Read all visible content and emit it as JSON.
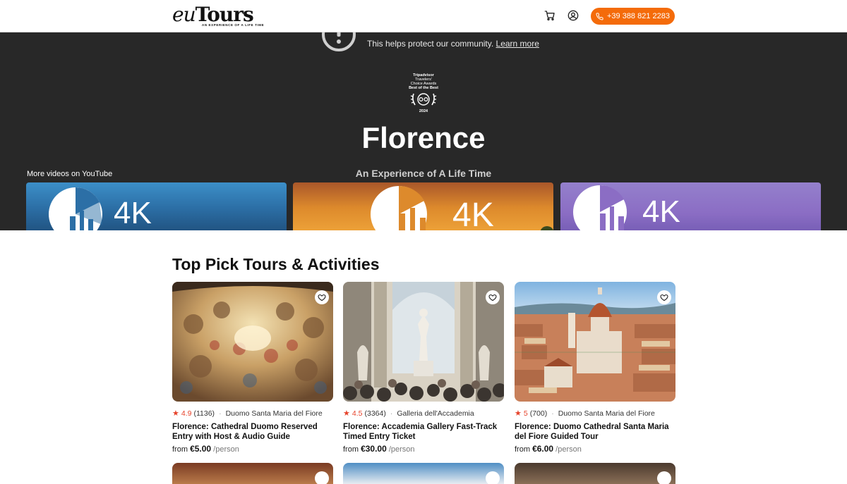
{
  "header": {
    "logo_main_prefix": "eu",
    "logo_main_suffix": "Tours",
    "logo_tagline": "AN EXPERIENCE OF A LIFE TIME",
    "phone_label": "+39 388 821 2283"
  },
  "hero": {
    "alert_text": "This helps protect our community.",
    "alert_link": "Learn more",
    "badge_lines": [
      "Tripadvisor",
      "Travelers'",
      "Choice Awards",
      "Best of the Best",
      "2024"
    ],
    "title": "Florence",
    "subtitle": "An Experience of A Life Time",
    "yt_label": "More videos on YouTube",
    "thumb_label": "4K"
  },
  "section": {
    "title": "Top Pick Tours & Activities"
  },
  "cards": [
    {
      "rating": "4.9",
      "reviews": "(1136)",
      "location": "Duomo Santa Maria del Fiore",
      "title": "Florence: Cathedral Duomo Reserved Entry with Host & Audio Guide",
      "from": "from",
      "price": "€5.00",
      "per": "/person"
    },
    {
      "rating": "4.5",
      "reviews": "(3364)",
      "location": "Galleria dell'Accademia",
      "title": "Florence: Accademia Gallery Fast-Track Timed Entry Ticket",
      "from": "from",
      "price": "€30.00",
      "per": "/person"
    },
    {
      "rating": "5",
      "reviews": "(700)",
      "location": "Duomo Santa Maria del Fiore",
      "title": "Florence: Duomo Cathedral Santa Maria del Fiore Guided Tour",
      "from": "from",
      "price": "€6.00",
      "per": "/person"
    }
  ],
  "colors": {
    "accent": "#f46b0a",
    "hero_bg": "#282828",
    "star": "#e6432b"
  }
}
